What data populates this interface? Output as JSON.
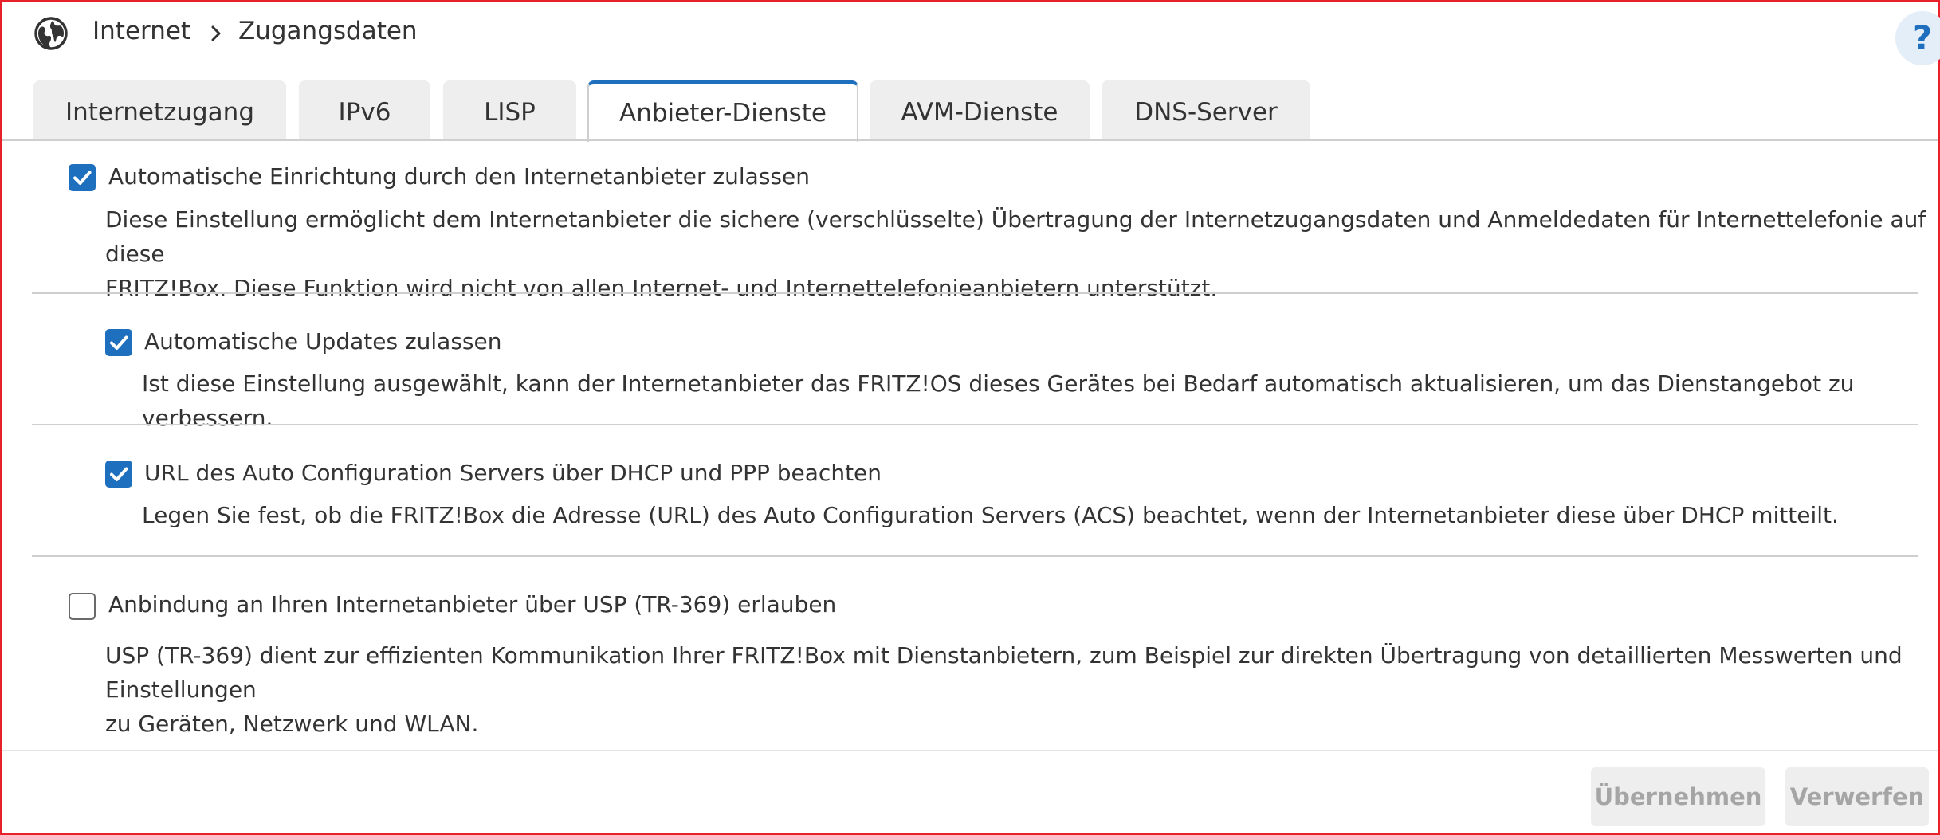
{
  "breadcrumb": {
    "icon": "globe-icon",
    "root": "Internet",
    "separator_icon": "chevron-right-icon",
    "current": "Zugangsdaten"
  },
  "help": {
    "label": "?",
    "icon": "help-icon"
  },
  "tabs": [
    {
      "label": "Internetzugang",
      "active": false
    },
    {
      "label": "IPv6",
      "active": false
    },
    {
      "label": "LISP",
      "active": false
    },
    {
      "label": "Anbieter-Dienste",
      "active": true
    },
    {
      "label": "AVM-Dienste",
      "active": false
    },
    {
      "label": "DNS-Server",
      "active": false
    }
  ],
  "settings": [
    {
      "label": "Automatische Einrichtung durch den Internetanbieter zulassen",
      "checked": true,
      "description_lines": [
        "Diese Einstellung ermöglicht dem Internetanbieter die sichere (verschlüsselte) Übertragung der Internetzugangsdaten und Anmeldedaten für Internettelefonie auf diese",
        "FRITZ!Box. Diese Funktion wird nicht von allen Internet- und Internettelefonieanbietern unterstützt."
      ]
    },
    {
      "label": "Automatische Updates zulassen",
      "checked": true,
      "description_lines": [
        "Ist diese Einstellung ausgewählt, kann der Internetanbieter das FRITZ!OS dieses Gerätes bei Bedarf automatisch aktualisieren, um das Dienstangebot zu verbessern."
      ]
    },
    {
      "label": "URL des Auto Configuration Servers über DHCP und PPP beachten",
      "checked": true,
      "description_lines": [
        "Legen Sie fest, ob die FRITZ!Box die Adresse (URL) des Auto Configuration Servers (ACS) beachtet, wenn der Internetanbieter diese über DHCP mitteilt."
      ]
    },
    {
      "label": "Anbindung an Ihren Internetanbieter über USP (TR-369) erlauben",
      "checked": false,
      "description_lines": [
        "USP (TR-369) dient zur effizienten Kommunikation Ihrer FRITZ!Box mit Dienstanbietern, zum Beispiel zur direkten Übertragung von detaillierten Messwerten und Einstellungen",
        "zu Geräten, Netzwerk und WLAN."
      ]
    }
  ],
  "buttons": {
    "apply": "Übernehmen",
    "discard": "Verwerfen"
  },
  "colors": {
    "accent": "#1f6fbf",
    "frame": "#e8202a",
    "disabled_button_bg": "#eeeeee",
    "disabled_button_text": "#a5a5a5"
  }
}
